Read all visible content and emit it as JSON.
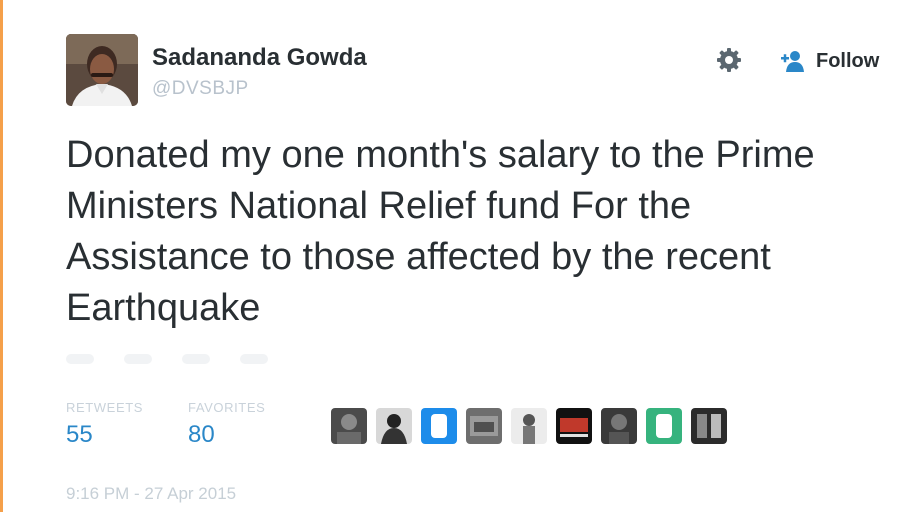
{
  "author": {
    "name": "Sadananda Gowda",
    "handle": "@DVSBJP"
  },
  "follow": {
    "label": "Follow"
  },
  "tweet": {
    "text": "Donated my one month's salary to the Prime Ministers National Relief fund For the Assistance to those affected by the recent Earthquake"
  },
  "stats": {
    "retweets_label": "RETWEETS",
    "retweets_value": "55",
    "favorites_label": "FAVORITES",
    "favorites_value": "80"
  },
  "timestamp": "9:16 PM - 27 Apr 2015",
  "colors": {
    "link": "#2a87c8",
    "accent": "#f5a04a",
    "muted": "#c6cfd6"
  },
  "icons": [
    "gear-icon",
    "follow-person-icon",
    "reply-icon",
    "retweet-icon",
    "favorite-icon",
    "more-icon"
  ]
}
